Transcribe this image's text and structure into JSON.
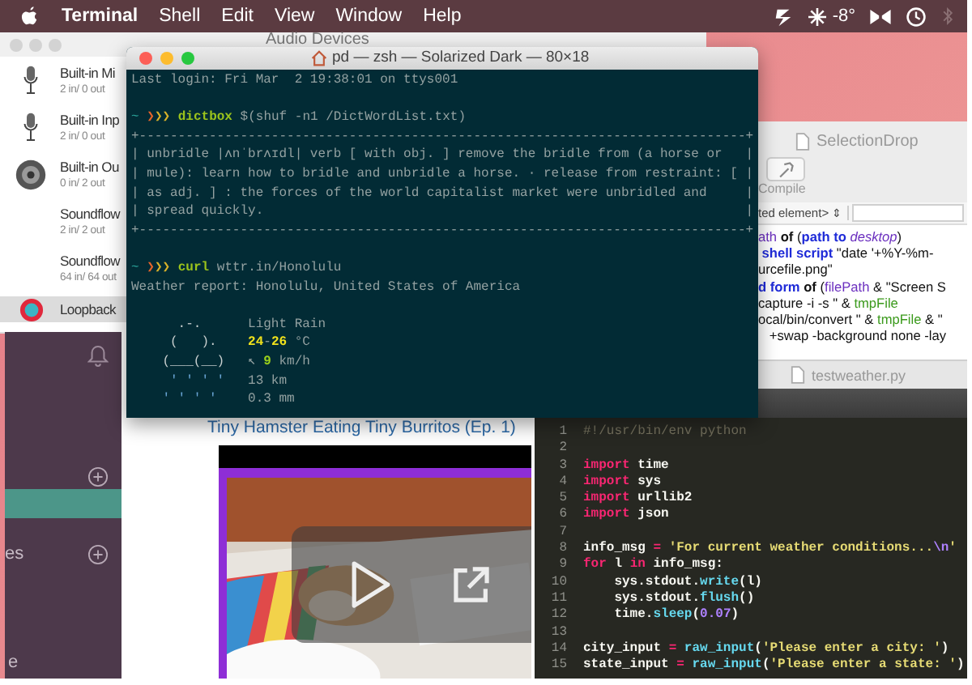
{
  "menu_bar": {
    "app": "Terminal",
    "items": [
      "Shell",
      "Edit",
      "View",
      "Window",
      "Help"
    ],
    "temperature": "-8°"
  },
  "audio_devices": {
    "title": "Audio Devices",
    "devices": [
      {
        "kind": "mic",
        "name": "Built-in Mi",
        "channels": "2 in/ 0 out",
        "selected": false
      },
      {
        "kind": "mic",
        "name": "Built-in Inp",
        "channels": "2 in/ 0 out",
        "selected": false
      },
      {
        "kind": "speaker",
        "name": "Built-in Ou",
        "channels": "0 in/ 2 out",
        "selected": false
      },
      {
        "kind": "none",
        "name": "Soundflow",
        "channels": "2 in/ 2 out",
        "selected": false
      },
      {
        "kind": "none",
        "name": "Soundflow",
        "channels": "64 in/ 64 out",
        "selected": false
      },
      {
        "kind": "loopback",
        "name": "Loopback",
        "selected": true
      }
    ]
  },
  "chat_sidebar": {
    "items": [
      {
        "kind": "header"
      },
      {
        "kind": "channel",
        "selected": true
      },
      {
        "kind": "header",
        "label": "es"
      },
      {
        "kind": "channel",
        "label": "e",
        "selected": false
      }
    ]
  },
  "video_page": {
    "title": "Tiny Hamster Eating Tiny Burritos (Ep. 1)"
  },
  "script_editor": {
    "title": "SelectionDrop",
    "compile": "Compile",
    "element_popup": "ted element>",
    "popup_arrows": "⇕",
    "lines": [
      [
        {
          "t": "ath",
          "kind": "var"
        },
        {
          "t": " of",
          "kind": "bold"
        },
        {
          "t": " (",
          "kind": "plain"
        },
        {
          "t": "path to",
          "kind": "kw"
        },
        {
          "t": " desktop",
          "kind": "ital"
        },
        {
          "t": ")",
          "kind": "plain"
        }
      ],
      [
        {
          "t": " shell script",
          "kind": "kw"
        },
        {
          "t": " \"date '+%Y-%m-",
          "kind": "plain"
        }
      ],
      [
        {
          "t": "urcefile.png\"",
          "kind": "plain"
        }
      ],
      [
        {
          "t": "d form",
          "kind": "kw"
        },
        {
          "t": " of",
          "kind": "bold"
        },
        {
          "t": " (",
          "kind": "plain"
        },
        {
          "t": "filePath",
          "kind": "var"
        },
        {
          "t": " & \"Screen S",
          "kind": "plain"
        }
      ],
      [
        {
          "t": "capture -i -s \" & ",
          "kind": "plain"
        },
        {
          "t": "tmpFile",
          "kind": "green"
        }
      ],
      [
        {
          "t": "ocal/bin/convert \" & ",
          "kind": "plain"
        },
        {
          "t": "tmpFile",
          "kind": "green"
        },
        {
          "t": " & \"",
          "kind": "plain"
        }
      ],
      [
        {
          "t": "   +swap -background none -lay",
          "kind": "plain"
        }
      ]
    ]
  },
  "python_editor": {
    "title": "testweather.py",
    "lines": [
      {
        "number": "1",
        "tokens": [
          {
            "t": "#!/usr/bin/env python",
            "kind": "comment"
          }
        ]
      },
      {
        "number": "2"
      },
      {
        "number": "3",
        "tokens": [
          {
            "t": "import",
            "kind": "kw"
          },
          {
            "t": " time",
            "kind": "plain"
          }
        ]
      },
      {
        "number": "4",
        "tokens": [
          {
            "t": "import",
            "kind": "kw"
          },
          {
            "t": " sys",
            "kind": "plain"
          }
        ]
      },
      {
        "number": "5",
        "tokens": [
          {
            "t": "import",
            "kind": "kw"
          },
          {
            "t": " urllib2",
            "kind": "plain"
          }
        ]
      },
      {
        "number": "6",
        "tokens": [
          {
            "t": "import",
            "kind": "kw"
          },
          {
            "t": " json",
            "kind": "plain"
          }
        ]
      },
      {
        "number": "7"
      },
      {
        "number": "8",
        "tokens": [
          {
            "t": "info_msg ",
            "kind": "plain"
          },
          {
            "t": "=",
            "kind": "kw"
          },
          {
            "t": " 'For current weather conditions...",
            "kind": "str"
          },
          {
            "t": "\\n",
            "kind": "num"
          },
          {
            "t": "'",
            "kind": "str"
          }
        ]
      },
      {
        "number": "9",
        "tokens": [
          {
            "t": "for",
            "kind": "kw"
          },
          {
            "t": " l ",
            "kind": "plain"
          },
          {
            "t": "in",
            "kind": "kw"
          },
          {
            "t": " info_msg:",
            "kind": "plain"
          }
        ]
      },
      {
        "number": "10",
        "tokens": [
          {
            "t": "    sys.stdout.",
            "kind": "plain"
          },
          {
            "t": "write",
            "kind": "fn"
          },
          {
            "t": "(l)",
            "kind": "plain"
          }
        ]
      },
      {
        "number": "11",
        "tokens": [
          {
            "t": "    sys.stdout.",
            "kind": "plain"
          },
          {
            "t": "flush",
            "kind": "fn"
          },
          {
            "t": "()",
            "kind": "plain"
          }
        ]
      },
      {
        "number": "12",
        "tokens": [
          {
            "t": "    time.",
            "kind": "plain"
          },
          {
            "t": "sleep",
            "kind": "fn"
          },
          {
            "t": "(",
            "kind": "plain"
          },
          {
            "t": "0.07",
            "kind": "num"
          },
          {
            "t": ")",
            "kind": "plain"
          }
        ]
      },
      {
        "number": "13"
      },
      {
        "number": "14",
        "tokens": [
          {
            "t": "city_input ",
            "kind": "plain"
          },
          {
            "t": "=",
            "kind": "kw"
          },
          {
            "t": " raw_input",
            "kind": "fn"
          },
          {
            "t": "(",
            "kind": "plain"
          },
          {
            "t": "'Please enter a city: '",
            "kind": "str"
          },
          {
            "t": ")",
            "kind": "plain"
          }
        ]
      },
      {
        "number": "15",
        "tokens": [
          {
            "t": "state_input ",
            "kind": "plain"
          },
          {
            "t": "=",
            "kind": "kw"
          },
          {
            "t": " raw_input",
            "kind": "fn"
          },
          {
            "t": "(",
            "kind": "plain"
          },
          {
            "t": "'Please enter a state: '",
            "kind": "str"
          },
          {
            "t": ")",
            "kind": "plain"
          }
        ]
      }
    ]
  },
  "terminal": {
    "title": "pd — zsh — Solarized Dark — 80×18",
    "lines": [
      {
        "kind": "text",
        "tokens": [
          {
            "t": "Last login: Fri Mar  2 19:38:01 on ttys001",
            "kind": "plain"
          }
        ]
      },
      {
        "kind": "blank"
      },
      {
        "kind": "prompt",
        "tokens": [
          {
            "t": "~",
            "kind": "cwd"
          },
          {
            "t": " ❯",
            "kind": "arrow1"
          },
          {
            "t": "❯❯",
            "kind": "arrow2"
          },
          {
            "t": " dictbox",
            "kind": "cmd"
          },
          {
            "t": " $(shuf -n1 /DictWordList.txt)",
            "kind": "plain"
          }
        ]
      },
      {
        "kind": "text",
        "tokens": [
          {
            "t": "+------------------------------------------------------------------------------+",
            "kind": "plain"
          }
        ]
      },
      {
        "kind": "text",
        "tokens": [
          {
            "t": "| unbridle |ʌnˈbrʌɪdl| verb [ with obj. ] remove the bridle from (a horse or   |",
            "kind": "plain"
          }
        ]
      },
      {
        "kind": "text",
        "tokens": [
          {
            "t": "| mule): learn how to bridle and unbridle a horse. · release from restraint: [ |",
            "kind": "plain"
          }
        ]
      },
      {
        "kind": "text",
        "tokens": [
          {
            "t": "| as adj. ] : the forces of the world capitalist market were unbridled and     |",
            "kind": "plain"
          }
        ]
      },
      {
        "kind": "text",
        "tokens": [
          {
            "t": "| spread quickly.                                                              |",
            "kind": "plain"
          }
        ]
      },
      {
        "kind": "text",
        "tokens": [
          {
            "t": "+------------------------------------------------------------------------------+",
            "kind": "plain"
          }
        ]
      },
      {
        "kind": "blank"
      },
      {
        "kind": "prompt",
        "tokens": [
          {
            "t": "~",
            "kind": "cwd"
          },
          {
            "t": " ❯",
            "kind": "arrow1"
          },
          {
            "t": "❯❯",
            "kind": "arrow2"
          },
          {
            "t": " curl",
            "kind": "cmd"
          },
          {
            "t": " wttr.in/Honolulu",
            "kind": "plain"
          }
        ]
      },
      {
        "kind": "text",
        "tokens": [
          {
            "t": "Weather report: Honolulu, United States of America",
            "kind": "plain"
          }
        ]
      },
      {
        "kind": "blank"
      },
      {
        "kind": "weather",
        "tokens": [
          {
            "t": "      .-.      ",
            "kind": "art"
          },
          {
            "t": "Light Rain",
            "kind": "plain"
          }
        ]
      },
      {
        "kind": "weather",
        "tokens": [
          {
            "t": "     (   ).    ",
            "kind": "art"
          },
          {
            "t": "24",
            "kind": "warm"
          },
          {
            "t": "-",
            "kind": "plain"
          },
          {
            "t": "26",
            "kind": "warm"
          },
          {
            "t": " °C",
            "kind": "plain"
          }
        ]
      },
      {
        "kind": "weather",
        "tokens": [
          {
            "t": "    (___(__)   ",
            "kind": "art"
          },
          {
            "t": "↖ ",
            "kind": "plain"
          },
          {
            "t": "9",
            "kind": "wind"
          },
          {
            "t": " km/h",
            "kind": "plain"
          }
        ]
      },
      {
        "kind": "weather",
        "tokens": [
          {
            "t": "     ' ' ' '   ",
            "kind": "rain"
          },
          {
            "t": "13 km",
            "kind": "plain"
          }
        ]
      },
      {
        "kind": "weather",
        "tokens": [
          {
            "t": "    ' ' ' '    ",
            "kind": "rain"
          },
          {
            "t": "0.3 mm",
            "kind": "plain"
          }
        ]
      }
    ]
  }
}
